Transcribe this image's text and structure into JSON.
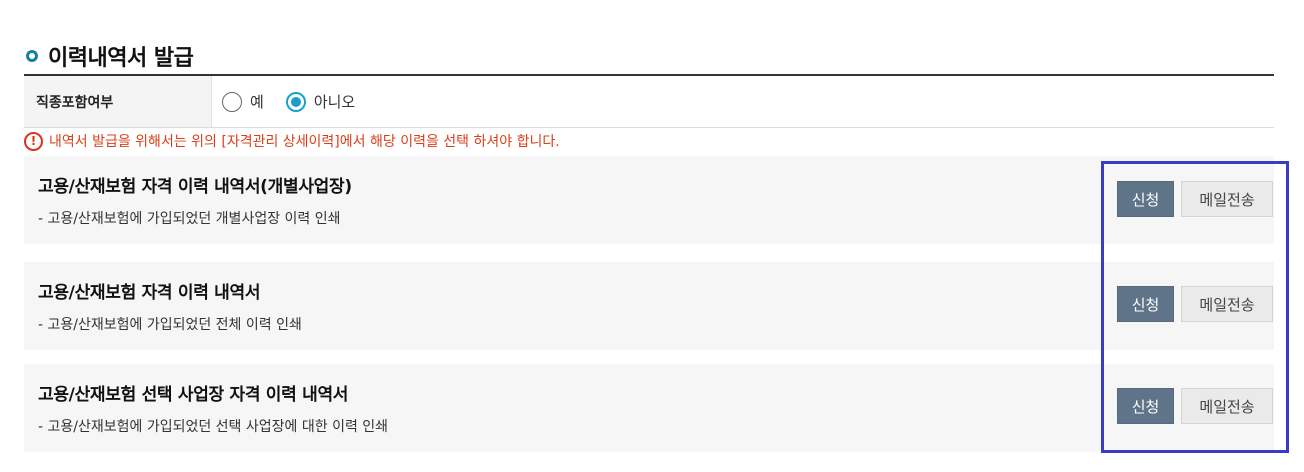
{
  "section": {
    "title": "이력내역서 발급"
  },
  "job_option": {
    "label": "직종포함여부",
    "options": [
      {
        "label": "예",
        "checked": false
      },
      {
        "label": "아니오",
        "checked": true
      }
    ]
  },
  "notice": "내역서 발급을 위해서는 위의 [자격관리 상세이력]에서 해당 이력을 선택 하셔야 합니다.",
  "cards": [
    {
      "title": "고용/산재보험 자격 이력 내역서(개별사업장)",
      "desc": "- 고용/산재보험에 가입되었던 개별사업장 이력 인쇄",
      "apply_label": "신청",
      "mail_label": "메일전송"
    },
    {
      "title": "고용/산재보험 자격 이력 내역서",
      "desc": "- 고용/산재보험에 가입되었던 전체 이력 인쇄",
      "apply_label": "신청",
      "mail_label": "메일전송"
    },
    {
      "title": "고용/산재보험 선택 사업장 자격 이력 내역서",
      "desc": "- 고용/산재보험에 가입되었던 선택 사업장에 대한 이력 인쇄",
      "apply_label": "신청",
      "mail_label": "메일전송"
    }
  ],
  "colors": {
    "accent": "#1aa0c8",
    "notice": "#d8401c",
    "apply_button": "#5f7488",
    "highlight": "#3a3cc4"
  }
}
